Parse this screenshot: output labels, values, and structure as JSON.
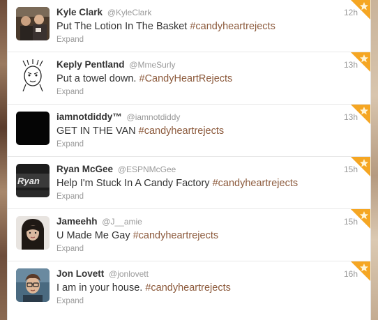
{
  "tweets": [
    {
      "fullname": "Kyle Clark",
      "username": "@KyleClark",
      "text": "Put The Lotion In The Basket ",
      "hashtag": "#candyheartrejects",
      "expand": "Expand",
      "time": "12h"
    },
    {
      "fullname": "Keply Pentland",
      "username": "@MmeSurly",
      "text": "Put a towel down. ",
      "hashtag": "#CandyHeartRejects",
      "expand": "Expand",
      "time": "13h"
    },
    {
      "fullname": "iamnotdiddy™",
      "username": "@iamnotdiddy",
      "text": "GET IN THE VAN ",
      "hashtag": "#candyheartrejects",
      "expand": "Expand",
      "time": "13h"
    },
    {
      "fullname": "Ryan McGee",
      "username": "@ESPNMcGee",
      "text": "Help I'm Stuck In A Candy Factory ",
      "hashtag": "#candyheartrejects",
      "expand": "Expand",
      "time": "15h",
      "avatar_text": "Ryan"
    },
    {
      "fullname": "Jameehh",
      "username": "@J__amie",
      "text": "U Made Me Gay ",
      "hashtag": "#candyheartrejects",
      "expand": "Expand",
      "time": "15h"
    },
    {
      "fullname": "Jon Lovett",
      "username": "@jonlovett",
      "text": "I am in your house. ",
      "hashtag": "#candyheartrejects",
      "expand": "Expand",
      "time": "16h"
    }
  ],
  "colors": {
    "hashtag": "#8c5a3c",
    "meta": "#999999",
    "text": "#333333",
    "favorite_badge": "#f5a623"
  },
  "icons": {
    "favorite": "star-icon"
  }
}
